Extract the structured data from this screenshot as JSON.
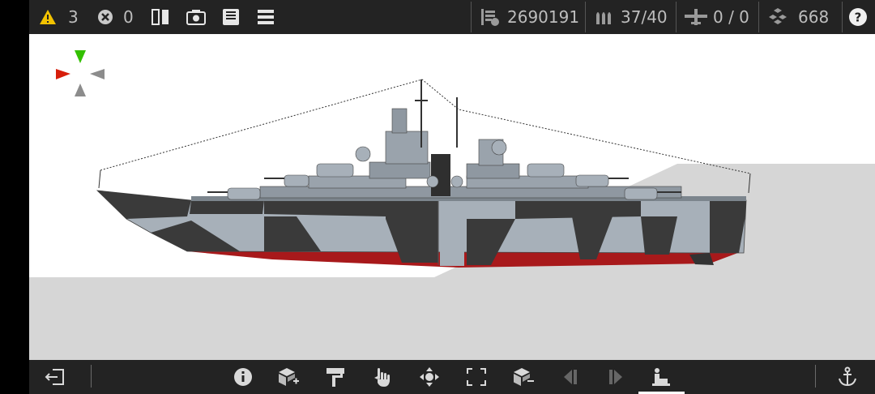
{
  "status": {
    "warnings_count": "3",
    "errors_count": "0",
    "cost": "2690191",
    "ammo": "37/40",
    "aircraft": "0 / 0",
    "parts": "668"
  },
  "toolbar_icons": {
    "warning": "warning-icon",
    "error": "error-icon",
    "mirror": "mirror-icon",
    "camera": "camera-icon",
    "save": "save-icon",
    "menu": "menu-icon",
    "cost": "cost-icon",
    "ammo": "ammo-icon",
    "aircraft": "aircraft-icon",
    "parts": "parts-icon",
    "help": "help-icon"
  },
  "bottom_icons": [
    "exit-icon",
    "info-icon",
    "add-block-icon",
    "paint-icon",
    "hand-icon",
    "move-icon",
    "resize-icon",
    "remove-block-icon",
    "step-back-icon",
    "step-forward-icon",
    "sit-icon",
    "anchor-icon"
  ],
  "colors": {
    "bar": "#232323",
    "warning_yellow": "#f2c200",
    "hull_dark": "#3a3a3a",
    "hull_light": "#a7b0b9",
    "hull_red": "#a8191b",
    "gizmo_green": "#33c000",
    "gizmo_red": "#d71e0b",
    "gizmo_gray": "#8c8c8c",
    "ground": "#d6d6d6"
  }
}
